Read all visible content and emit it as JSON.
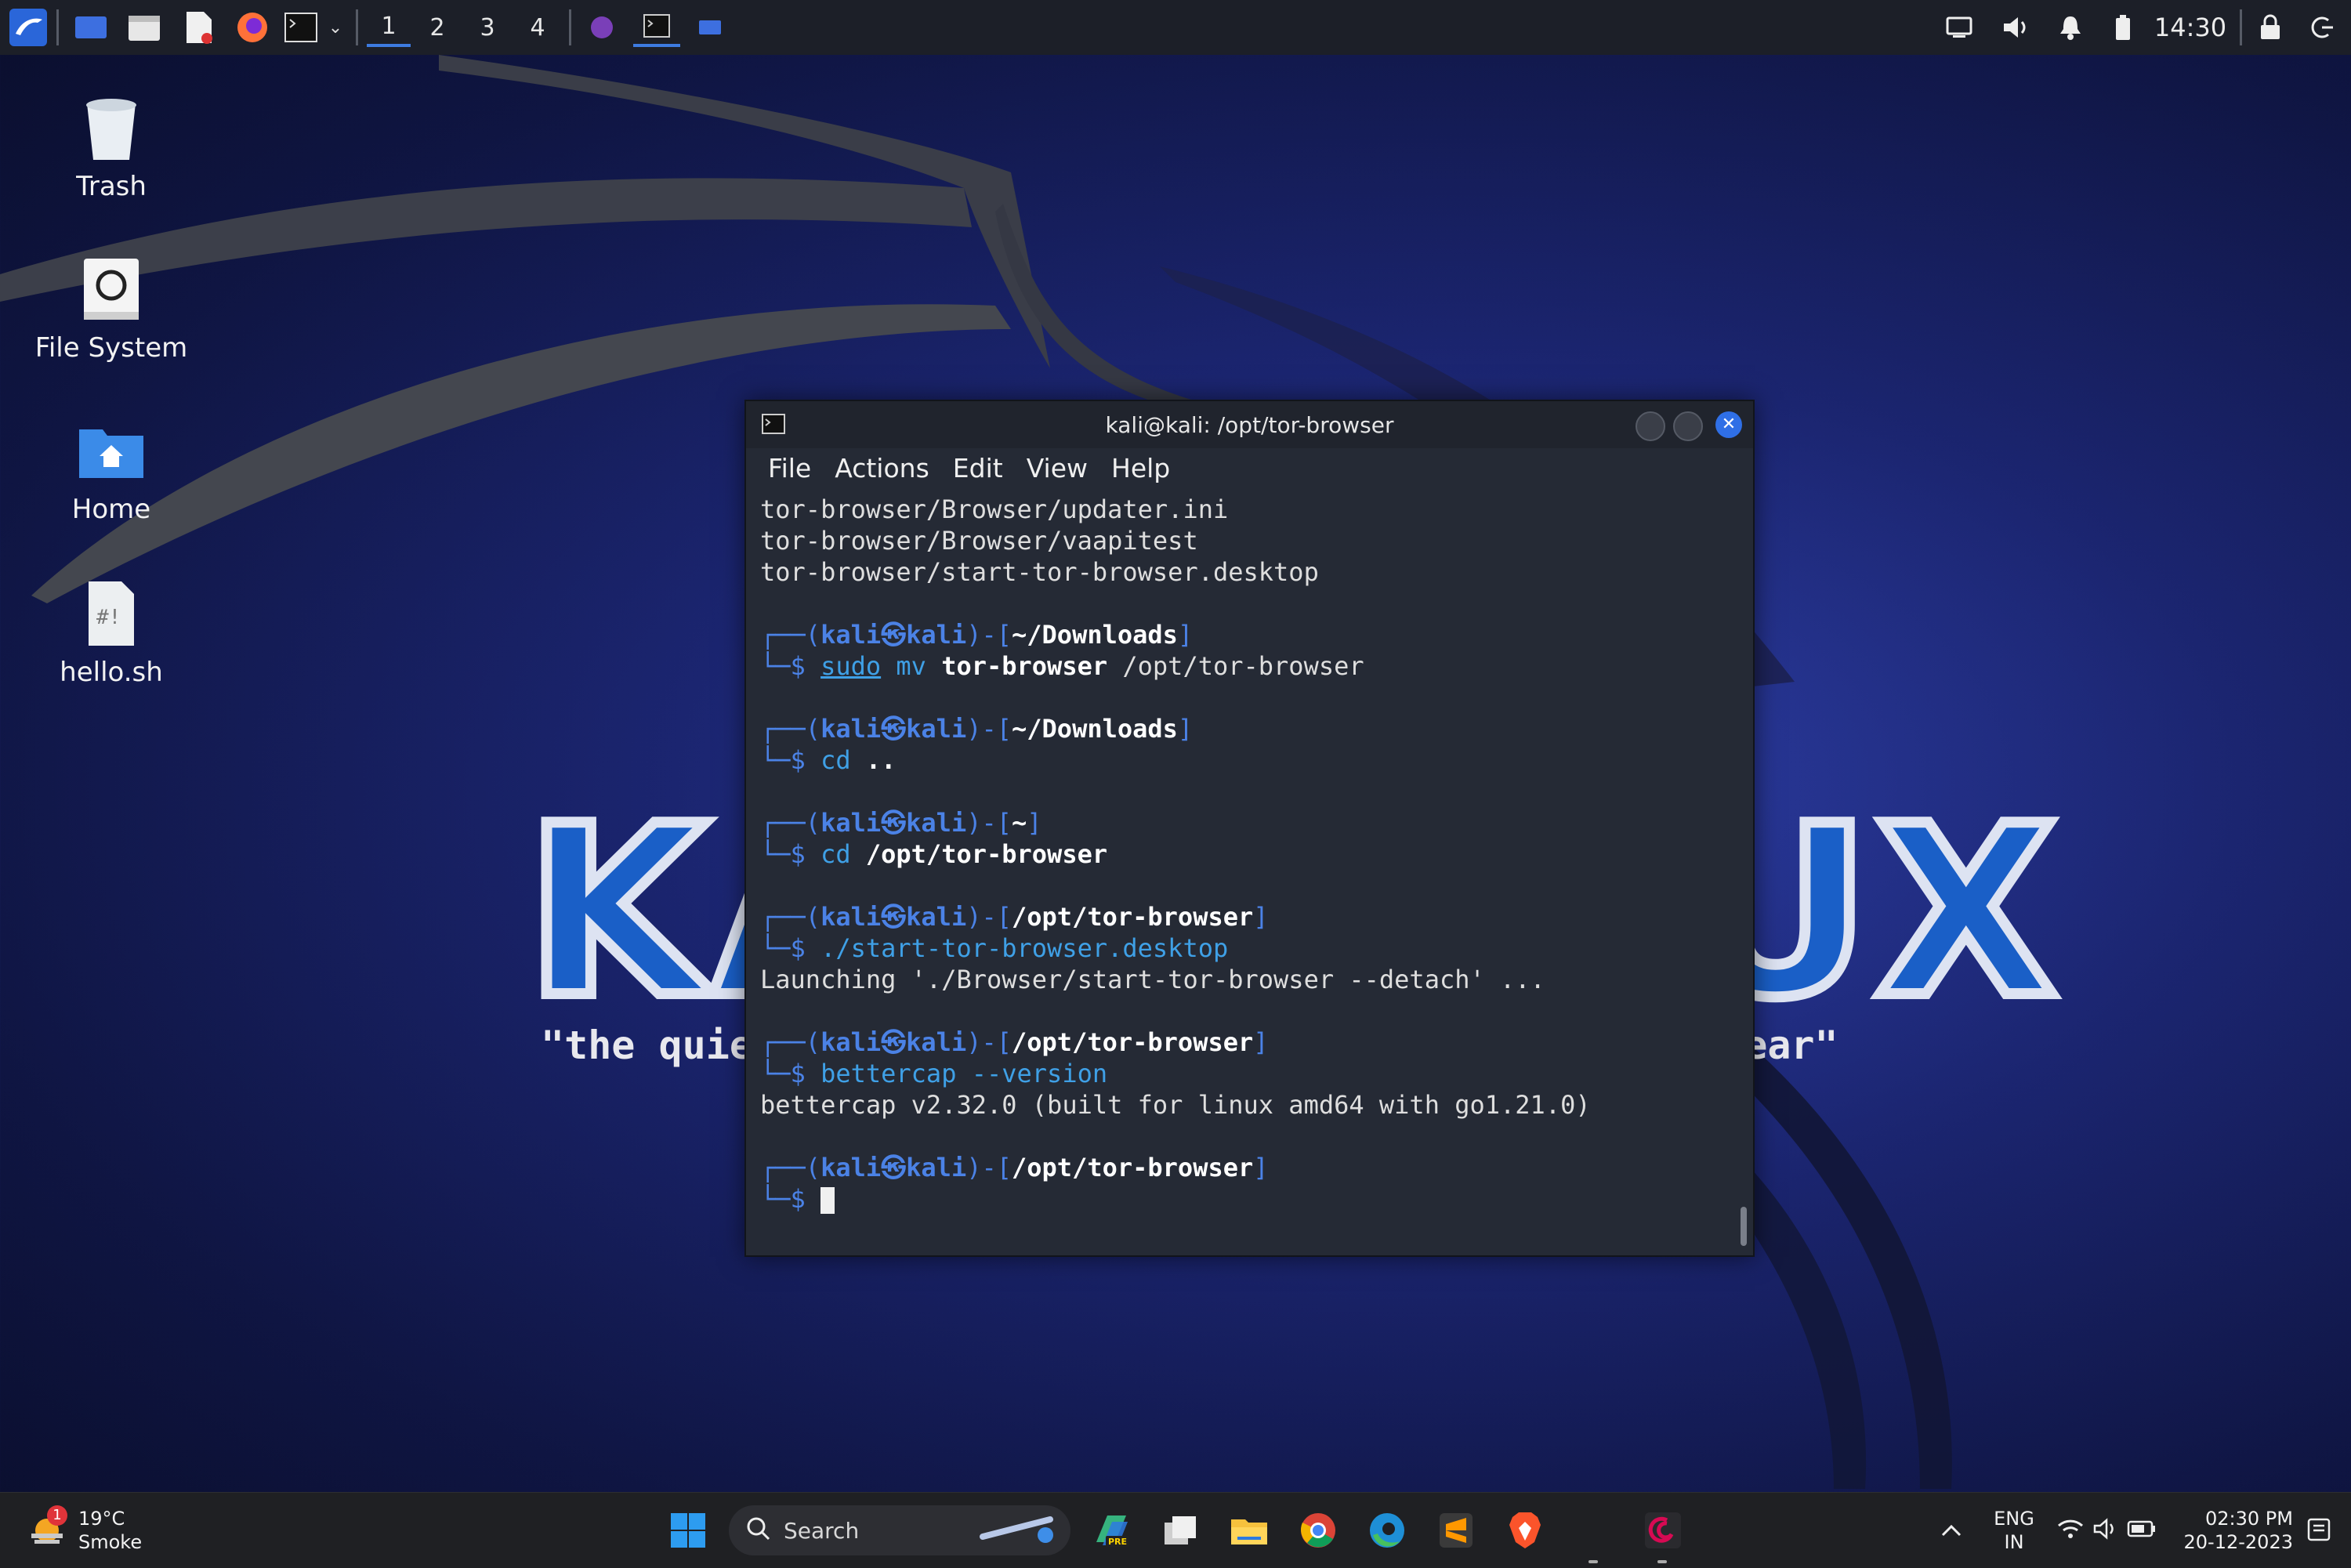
{
  "kali_panel": {
    "workspaces": [
      "1",
      "2",
      "3",
      "4"
    ],
    "active_workspace": "1",
    "clock": "14:30",
    "icons": [
      "kali-menu-icon",
      "desktop-icon",
      "file-manager-icon",
      "text-editor-icon",
      "firefox-icon",
      "terminal-icon",
      "chevron-down-icon",
      "tor-icon",
      "terminal-window-icon",
      "window-icon",
      "display-icon",
      "volume-icon",
      "bell-icon",
      "battery-icon",
      "lock-icon",
      "logout-icon"
    ]
  },
  "desktop": {
    "icons": [
      {
        "label": "Trash",
        "icon": "trash-icon"
      },
      {
        "label": "File System",
        "icon": "drive-icon"
      },
      {
        "label": "Home",
        "icon": "home-folder-icon"
      },
      {
        "label": "hello.sh",
        "icon": "script-file-icon"
      }
    ],
    "wallpaper_logo_text": "KALI LINUX",
    "wallpaper_tagline": "\"the quieter you become, the more you are able to hear\""
  },
  "terminal": {
    "title": "kali@kali: /opt/tor-browser",
    "menu": [
      "File",
      "Actions",
      "Edit",
      "View",
      "Help"
    ],
    "prompt_user": "kali",
    "prompt_host": "kali",
    "output_top": [
      "tor-browser/Browser/updater.ini",
      "tor-browser/Browser/vaapitest",
      "tor-browser/start-tor-browser.desktop"
    ],
    "blocks": [
      {
        "dir": "~/Downloads",
        "cmd": "sudo",
        "rest_cmd": "mv",
        "args": "tor-browser",
        "tail": " /opt/tor-browser"
      },
      {
        "dir": "~/Downloads",
        "cmd": "cd",
        "args": "..",
        "tail": ""
      },
      {
        "dir": "~",
        "cmd": "cd",
        "args": "/opt/tor-browser",
        "tail": ""
      },
      {
        "dir": "/opt/tor-browser",
        "cmd": "./start-tor-browser.desktop",
        "args": "",
        "tail": "",
        "output": "Launching './Browser/start-tor-browser --detach' ..."
      },
      {
        "dir": "/opt/tor-browser",
        "cmd": "bettercap",
        "args": "",
        "tail": " --version",
        "output": "bettercap v2.32.0 (built for linux amd64 with go1.21.0)"
      },
      {
        "dir": "/opt/tor-browser",
        "cmd": "",
        "args": "",
        "tail": ""
      }
    ]
  },
  "taskbar": {
    "weather_temp": "19°C",
    "weather_desc": "Smoke",
    "weather_badge": "1",
    "search_placeholder": "Search",
    "language_line1": "ENG",
    "language_line2": "IN",
    "time": "02:30 PM",
    "date": "20-12-2023",
    "pinned": [
      "windows-start-icon",
      "search-icon",
      "copilot-preview-icon",
      "task-view-icon",
      "file-explorer-icon",
      "chrome-icon",
      "edge-icon",
      "sublime-text-icon",
      "brave-icon",
      "debian-kali-icon"
    ],
    "tray": [
      "chevron-up-icon",
      "wifi-icon",
      "speaker-icon",
      "battery-icon",
      "notification-icon"
    ]
  }
}
